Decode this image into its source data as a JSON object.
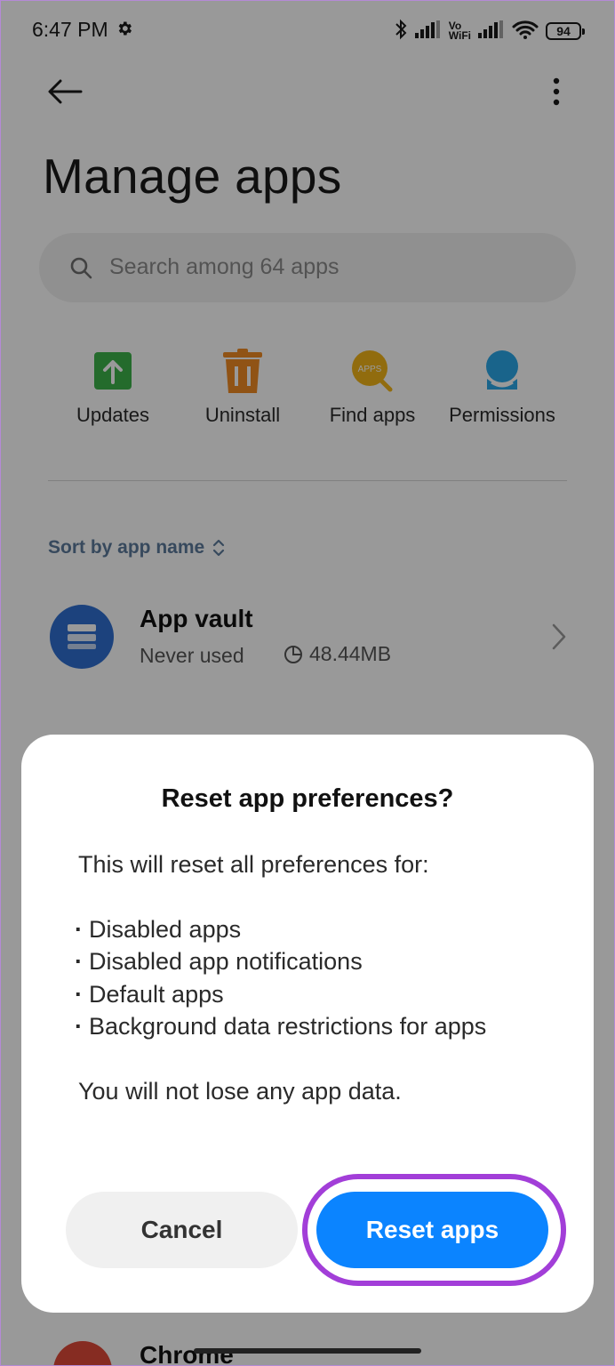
{
  "status_bar": {
    "time": "6:47 PM",
    "vowifi_top": "Vo",
    "vowifi_bottom": "WiFi",
    "battery": "94"
  },
  "header": {
    "title": "Manage apps"
  },
  "search": {
    "placeholder": "Search among 64 apps"
  },
  "quick_actions": [
    {
      "label": "Updates",
      "icon": "upload-arrow-icon",
      "color": "#3cb24a"
    },
    {
      "label": "Uninstall",
      "icon": "trash-icon",
      "color": "#f08a24"
    },
    {
      "label": "Find apps",
      "icon": "find-apps-icon",
      "color": "#f2b418",
      "badge": "APPS"
    },
    {
      "label": "Permissions",
      "icon": "permissions-icon",
      "color": "#2aa7e8"
    }
  ],
  "sort": {
    "label": "Sort by app name"
  },
  "apps": [
    {
      "name": "App vault",
      "usage": "Never used",
      "size": "48.44MB",
      "icon": "app-vault-icon",
      "color": "#2f6fd0"
    },
    {
      "name": "Chrome",
      "icon": "chrome-icon"
    }
  ],
  "dialog": {
    "title": "Reset app preferences?",
    "intro": "This will reset all preferences for:",
    "items": [
      "Disabled apps",
      "Disabled app notifications",
      "Default apps",
      "Background data restrictions for apps"
    ],
    "footer": "You will not lose any app data.",
    "cancel_label": "Cancel",
    "confirm_label": "Reset apps"
  },
  "colors": {
    "accent": "#0b84ff",
    "highlight": "#a23ed8",
    "sort_label": "#5d7b9c"
  }
}
